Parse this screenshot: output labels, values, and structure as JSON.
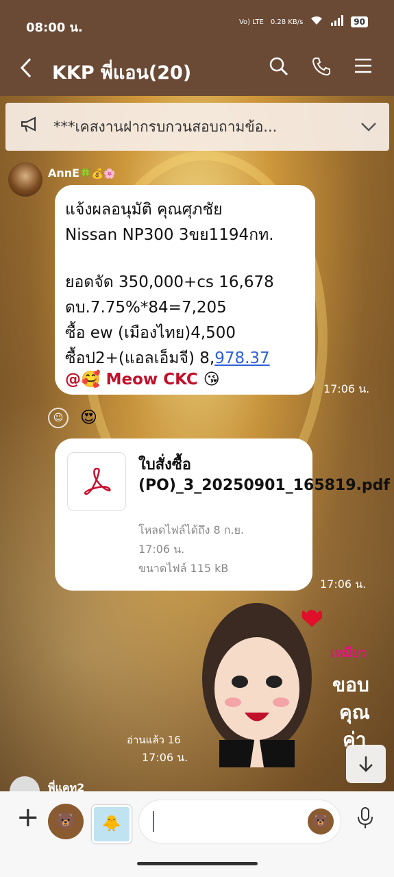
{
  "status_bar": {
    "time": "08:00 น.",
    "volte": "Vo) LTE",
    "net_speed": "0.28 KB/s",
    "battery": "90"
  },
  "header": {
    "title": "KKP พี่แอน(20)",
    "back_icon": "chevron-left-icon",
    "search_icon": "search-icon",
    "call_icon": "phone-icon",
    "menu_icon": "hamburger-icon"
  },
  "announcement": {
    "text": "***เคสงานฝากรบกวนสอบถามข้อ..."
  },
  "messages": [
    {
      "sender": "AnnE",
      "sender_emojis": "🍀💰🌸",
      "lines": [
        "แจ้งผลอนุมัติ คุณศุภชัย",
        "Nissan NP300 3ขย1194กท.",
        "",
        "ยอดจัด 350,000+cs 16,678",
        "ดบ.7.75%*84=7,205",
        "ซื้อ ew (เมืองไทย)4,500"
      ],
      "line_last_prefix": "ซื้อป2+(แอลเอ็มจี) 8,",
      "line_last_link": "978.37",
      "mention_prefix": "@🥰",
      "mention_name": " Meow CKC ",
      "mention_suffix": "😘",
      "time": "17:06 น.",
      "reaction": "😍"
    },
    {
      "file_name": "ใบสั่งซื้อ (PO)_3_20250901_165819.pdf",
      "file_expiry": "โหลดไฟล์ได้ถึง 8 ก.ย.",
      "file_expiry_time": "17:06 น.",
      "file_size": "ขนาดไฟล์ 115 kB",
      "time": "17:06 น."
    },
    {
      "sticker_text_1": "เหมียว",
      "sticker_text_2": "ขอบ",
      "sticker_text_3": "คุณ",
      "sticker_text_4": "ค่า",
      "read_label": "อ่านแล้ว 16",
      "time": "17:06 น."
    }
  ],
  "next_sender": "พี่แคท2",
  "composer": {
    "plus_icon": "plus-icon",
    "sticker_icon": "brown-bear-sticker-icon",
    "photo_icon": "photo-icon",
    "emoji_icon": "emoji-face-icon",
    "mic_icon": "microphone-icon"
  },
  "colors": {
    "header_bg": "#6b4a35",
    "link": "#2f5fd6",
    "mention": "#c0102a",
    "pdf_red": "#c8102e"
  }
}
